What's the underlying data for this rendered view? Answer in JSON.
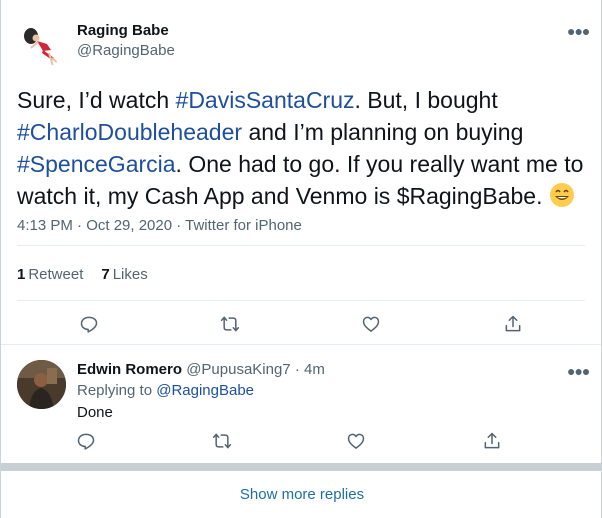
{
  "tweet": {
    "author_name": "Raging Babe",
    "author_handle": "@RagingBabe",
    "text_parts": [
      {
        "text": "Sure, I’d watch ",
        "type": "plain"
      },
      {
        "text": "#DavisSantaCruz",
        "type": "hashtag"
      },
      {
        "text": ". But, I bought ",
        "type": "plain"
      },
      {
        "text": "#CharloDoubleheader",
        "type": "hashtag"
      },
      {
        "text": " and I’m planning on buying ",
        "type": "plain"
      },
      {
        "text": "#SpenceGarcia",
        "type": "hashtag"
      },
      {
        "text": ". One had to go. If you really want me to watch it, my Cash App and Venmo is $RagingBabe. ",
        "type": "plain"
      }
    ],
    "emoji": "grinning-face-emoji",
    "timestamp": "4:13 PM · Oct 29, 2020 · Twitter for iPhone",
    "retweets_count": "1",
    "retweets_label": "Retweet",
    "likes_count": "7",
    "likes_label": "Likes"
  },
  "actions": [
    "reply-icon",
    "retweet-icon",
    "like-icon",
    "share-icon"
  ],
  "reply": {
    "author_name": "Edwin Romero",
    "author_handle": "@PupusaKing7",
    "time": "· 4m",
    "replying_prefix": "Replying to ",
    "replying_to": "@RagingBabe",
    "text": "Done"
  },
  "show_more": "Show more replies",
  "colors": {
    "hashtag": "#1d4f9e",
    "secondary_text": "#536471",
    "link": "#1d6fa3"
  }
}
